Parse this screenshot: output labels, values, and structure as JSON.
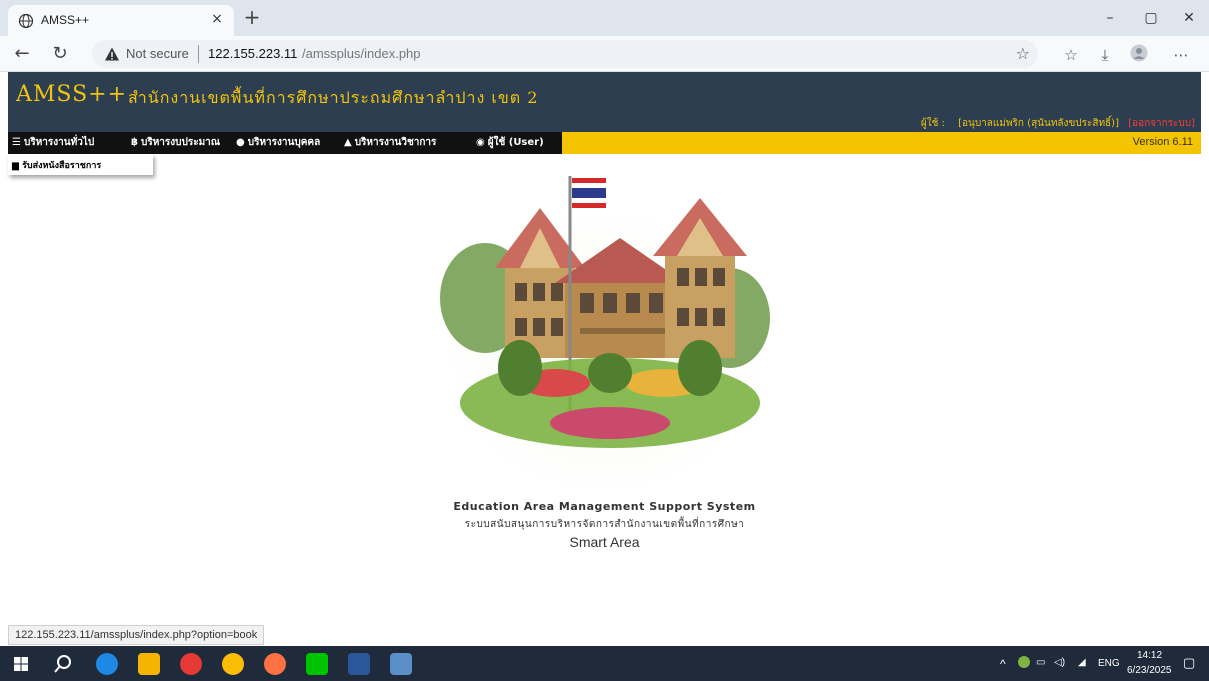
{
  "browser": {
    "tab_title": "AMSS++",
    "tab_close": "×",
    "new_tab": "+",
    "minimize": "–",
    "restore": "▢",
    "close": "✕",
    "not_secure": "Not secure",
    "url_host": "122.155.223.11",
    "url_path": "/amssplus/index.php",
    "status_url": "122.155.223.11/amssplus/index.php?option=book"
  },
  "header": {
    "brand": "AMSS++",
    "org_name": "สำนักงานเขตพื้นที่การศึกษาประถมศึกษาลำปาง เขต 2",
    "user_label": "ผู้ใช้ :",
    "user_name": "[อนุบาลแม่พริก (สุนันทลังขประสิทธิ์)]",
    "logout": "[ออกจากระบบ]"
  },
  "menu": {
    "items": [
      {
        "label": "บริหารงานทั่วไป",
        "icon": "list-icon"
      },
      {
        "label": "บริหารงบประมาณ",
        "icon": "money-icon"
      },
      {
        "label": "บริหารงานบุคคล",
        "icon": "user-icon"
      },
      {
        "label": "บริหารงานวิชาการ",
        "icon": "graduation-icon"
      },
      {
        "label": "ผู้ใช้ (User)",
        "icon": "user-circle-icon"
      }
    ],
    "version": "Version 6.11",
    "dropdown_item": "รับส่งหนังสือราชการ"
  },
  "caption": {
    "line1": "Education Area Management Support System",
    "line2": "ระบบสนับสนุนการบริหารจัดการสำนักงานเขตพื้นที่การศึกษา",
    "line3": "Smart Area"
  },
  "taskbar": {
    "language": "ENG",
    "time": "14:12",
    "date": "6/23/2025"
  },
  "colors": {
    "header_bg": "#2c3e50",
    "brand_yellow": "#f1c40f",
    "menu_yellow": "#f5c400",
    "menu_dark": "#111111",
    "logout_red": "#ff3b30"
  }
}
